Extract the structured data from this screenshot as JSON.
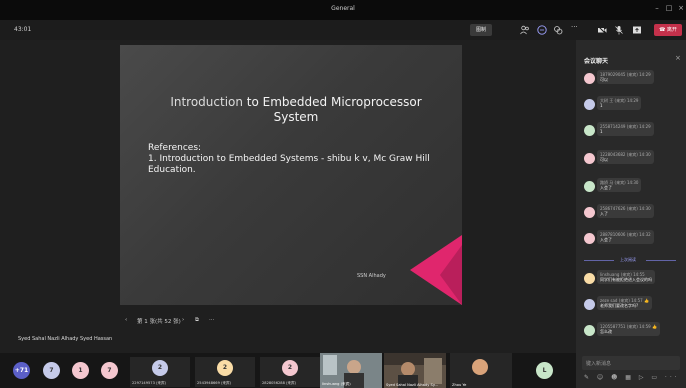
{
  "window": {
    "title": "General"
  },
  "toolbar": {
    "timer": "43:01",
    "record_label": "图制",
    "leave_label": "离开"
  },
  "slide": {
    "title_line1_plain": "Introduction",
    "title_line1_rest": " to Embedded Microprocessor",
    "title_line2": "System",
    "ref_heading": "References:",
    "ref_line1": "1. Introduction to Embedded Systems - shibu k v, Mc Graw Hill",
    "ref_line2": "Education.",
    "author": "SSN Alhady"
  },
  "slide_nav": {
    "prev": "‹",
    "page": "第 1 张(共 52 张)",
    "next": "›",
    "more": "···"
  },
  "presenter": {
    "name": "Syed Sahal Nazli Alhady Syed Hassan"
  },
  "participants": {
    "overflow": "+71",
    "avatars": [
      "7",
      "1",
      "7"
    ],
    "tiles": [
      {
        "initial": "2",
        "label": "2297149573 (来宾)"
      },
      {
        "initial": "2",
        "label": "2543948669 (来宾)"
      },
      {
        "initial": "2",
        "label": "2828056288 (来宾)"
      }
    ],
    "videos": [
      {
        "label": "linshuang (来宾)"
      },
      {
        "label": "Syed Sahal Nazli Alhady Sy..."
      },
      {
        "label": "Zhou Ye"
      }
    ],
    "last_avatar": "L"
  },
  "chat": {
    "title": "会议聊天",
    "messages": [
      {
        "name": "1879029045 (来宾)",
        "time": "14:29",
        "text": "可以"
      },
      {
        "name": "大树 王 (来宾)",
        "time": "14:29",
        "text": "1"
      },
      {
        "name": "2558714249 (来宾)",
        "time": "14:29",
        "text": "1"
      },
      {
        "name": "1228043682 (来宾)",
        "time": "14:30",
        "text": "可以"
      },
      {
        "name": "路娇 马 (来宾)",
        "time": "14:30",
        "text": "入会了"
      },
      {
        "name": "2586747626 (来宾)",
        "time": "14:30",
        "text": "入了"
      },
      {
        "name": "2887810606 (来宾)",
        "time": "14:32",
        "text": "入会了"
      }
    ],
    "divider": "上次阅读",
    "later": [
      {
        "name": "linshuang (来宾)",
        "time": "14:55",
        "text": "同学们有被拒绝进入会议的吗"
      },
      {
        "name": "zeze sad (来宾)",
        "time": "14:57",
        "text": "老师我们要改名字吗?"
      },
      {
        "name": "1205587751 (来宾)",
        "time": "14:59",
        "text": "怎么改"
      }
    ],
    "compose_placeholder": "键入新消息",
    "compose_icons": "✎ ☺ ☻ ▦ ▷ ▭ ···"
  },
  "colors": {
    "accent": "#6264a7",
    "leave": "#c4314b",
    "slide_accent": "#e0266d"
  }
}
